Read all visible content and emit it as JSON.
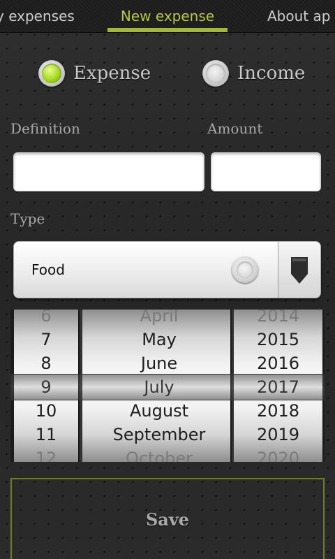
{
  "tabs": [
    {
      "label": "My expenses",
      "visible_fragment": "y expenses"
    },
    {
      "label": "New expense"
    },
    {
      "label": "About app",
      "visible_fragment": "About ap"
    }
  ],
  "colors": {
    "accent": "#a3b83a",
    "accent_text": "#b7c93a",
    "save_border": "#6f7f1e"
  },
  "type_radio": {
    "expense_label": "Expense",
    "income_label": "Income",
    "selected": "Expense"
  },
  "form": {
    "definition_label": "Definition",
    "definition_value": "",
    "amount_label": "Amount",
    "amount_value": "",
    "type_label": "Type",
    "type_value": "Food"
  },
  "date_picker": {
    "days": [
      "6",
      "7",
      "8",
      "9",
      "10",
      "11",
      "12"
    ],
    "months": [
      "April",
      "May",
      "June",
      "July",
      "August",
      "September",
      "October"
    ],
    "years": [
      "2014",
      "2015",
      "2016",
      "2017",
      "2018",
      "2019",
      "2020"
    ],
    "selected": {
      "day": "9",
      "month": "July",
      "year": "2017"
    }
  },
  "save_label": "Save",
  "icons": {
    "dropdown": "dropdown-arrow-icon"
  }
}
